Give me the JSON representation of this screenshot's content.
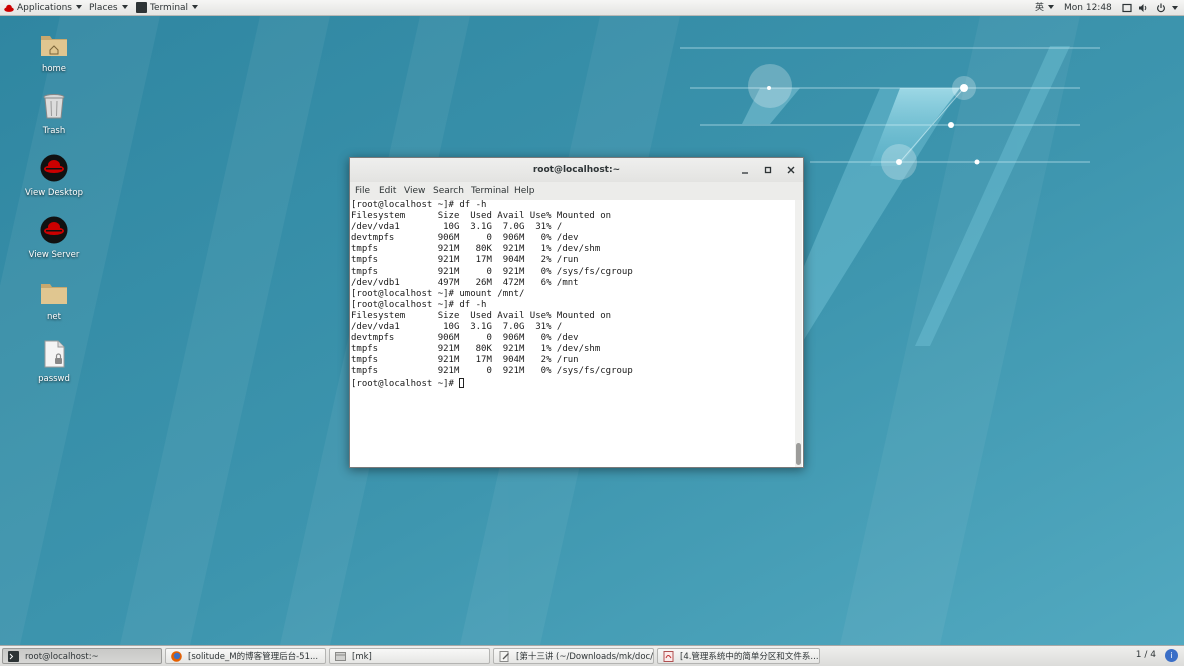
{
  "top_panel": {
    "applications": "Applications",
    "places": "Places",
    "terminal": "Terminal",
    "input_method": "英",
    "clock": "Mon 12:48"
  },
  "desktop_icons": [
    {
      "label": "home",
      "icon": "home-folder-icon"
    },
    {
      "label": "Trash",
      "icon": "trash-icon"
    },
    {
      "label": "View Desktop",
      "icon": "redhat-desktop-icon"
    },
    {
      "label": "View Server",
      "icon": "redhat-server-icon"
    },
    {
      "label": "net",
      "icon": "folder-icon"
    },
    {
      "label": "passwd",
      "icon": "text-file-icon"
    }
  ],
  "terminal": {
    "title": "root@localhost:~",
    "menu": [
      "File",
      "Edit",
      "View",
      "Search",
      "Terminal",
      "Help"
    ],
    "output": "[root@localhost ~]# df -h\nFilesystem      Size  Used Avail Use% Mounted on\n/dev/vda1        10G  3.1G  7.0G  31% /\ndevtmpfs        906M     0  906M   0% /dev\ntmpfs           921M   80K  921M   1% /dev/shm\ntmpfs           921M   17M  904M   2% /run\ntmpfs           921M     0  921M   0% /sys/fs/cgroup\n/dev/vdb1       497M   26M  472M   6% /mnt\n[root@localhost ~]# umount /mnt/\n[root@localhost ~]# df -h\nFilesystem      Size  Used Avail Use% Mounted on\n/dev/vda1        10G  3.1G  7.0G  31% /\ndevtmpfs        906M     0  906M   0% /dev\ntmpfs           921M   80K  921M   1% /dev/shm\ntmpfs           921M   17M  904M   2% /run\ntmpfs           921M     0  921M   0% /sys/fs/cgroup",
    "prompt": "[root@localhost ~]# "
  },
  "taskbar": {
    "tasks": [
      {
        "label": "root@localhost:~",
        "icon": "terminal-icon",
        "active": true
      },
      {
        "label": "[solitude_M的博客管理后台-51...",
        "icon": "firefox-icon",
        "active": false
      },
      {
        "label": "[mk]",
        "icon": "file-manager-icon",
        "active": false
      },
      {
        "label": "[第十三讲 (~/Downloads/mk/doc/...",
        "icon": "text-editor-icon",
        "active": false
      },
      {
        "label": "[4.管理系统中的简单分区和文件系...",
        "icon": "document-viewer-icon",
        "active": false
      }
    ],
    "workspace": "1 / 4"
  },
  "colors": {
    "wallpaper": "#3f94ad",
    "panel": "#e8e8e6",
    "terminal_bg": "#ffffff"
  }
}
